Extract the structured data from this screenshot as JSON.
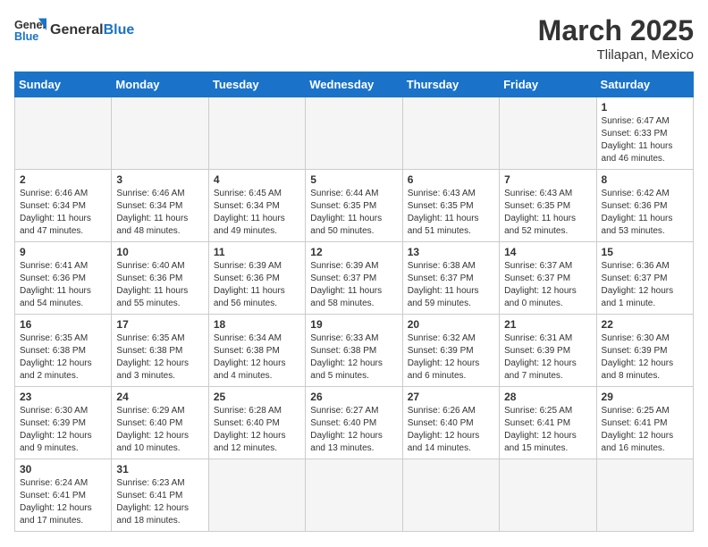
{
  "header": {
    "logo_general": "General",
    "logo_blue": "Blue",
    "month": "March 2025",
    "location": "Tlilapan, Mexico"
  },
  "weekdays": [
    "Sunday",
    "Monday",
    "Tuesday",
    "Wednesday",
    "Thursday",
    "Friday",
    "Saturday"
  ],
  "weeks": [
    [
      {
        "day": "",
        "info": ""
      },
      {
        "day": "",
        "info": ""
      },
      {
        "day": "",
        "info": ""
      },
      {
        "day": "",
        "info": ""
      },
      {
        "day": "",
        "info": ""
      },
      {
        "day": "",
        "info": ""
      },
      {
        "day": "1",
        "info": "Sunrise: 6:47 AM\nSunset: 6:33 PM\nDaylight: 11 hours\nand 46 minutes."
      }
    ],
    [
      {
        "day": "2",
        "info": "Sunrise: 6:46 AM\nSunset: 6:34 PM\nDaylight: 11 hours\nand 47 minutes."
      },
      {
        "day": "3",
        "info": "Sunrise: 6:46 AM\nSunset: 6:34 PM\nDaylight: 11 hours\nand 48 minutes."
      },
      {
        "day": "4",
        "info": "Sunrise: 6:45 AM\nSunset: 6:34 PM\nDaylight: 11 hours\nand 49 minutes."
      },
      {
        "day": "5",
        "info": "Sunrise: 6:44 AM\nSunset: 6:35 PM\nDaylight: 11 hours\nand 50 minutes."
      },
      {
        "day": "6",
        "info": "Sunrise: 6:43 AM\nSunset: 6:35 PM\nDaylight: 11 hours\nand 51 minutes."
      },
      {
        "day": "7",
        "info": "Sunrise: 6:43 AM\nSunset: 6:35 PM\nDaylight: 11 hours\nand 52 minutes."
      },
      {
        "day": "8",
        "info": "Sunrise: 6:42 AM\nSunset: 6:36 PM\nDaylight: 11 hours\nand 53 minutes."
      }
    ],
    [
      {
        "day": "9",
        "info": "Sunrise: 6:41 AM\nSunset: 6:36 PM\nDaylight: 11 hours\nand 54 minutes."
      },
      {
        "day": "10",
        "info": "Sunrise: 6:40 AM\nSunset: 6:36 PM\nDaylight: 11 hours\nand 55 minutes."
      },
      {
        "day": "11",
        "info": "Sunrise: 6:39 AM\nSunset: 6:36 PM\nDaylight: 11 hours\nand 56 minutes."
      },
      {
        "day": "12",
        "info": "Sunrise: 6:39 AM\nSunset: 6:37 PM\nDaylight: 11 hours\nand 58 minutes."
      },
      {
        "day": "13",
        "info": "Sunrise: 6:38 AM\nSunset: 6:37 PM\nDaylight: 11 hours\nand 59 minutes."
      },
      {
        "day": "14",
        "info": "Sunrise: 6:37 AM\nSunset: 6:37 PM\nDaylight: 12 hours\nand 0 minutes."
      },
      {
        "day": "15",
        "info": "Sunrise: 6:36 AM\nSunset: 6:37 PM\nDaylight: 12 hours\nand 1 minute."
      }
    ],
    [
      {
        "day": "16",
        "info": "Sunrise: 6:35 AM\nSunset: 6:38 PM\nDaylight: 12 hours\nand 2 minutes."
      },
      {
        "day": "17",
        "info": "Sunrise: 6:35 AM\nSunset: 6:38 PM\nDaylight: 12 hours\nand 3 minutes."
      },
      {
        "day": "18",
        "info": "Sunrise: 6:34 AM\nSunset: 6:38 PM\nDaylight: 12 hours\nand 4 minutes."
      },
      {
        "day": "19",
        "info": "Sunrise: 6:33 AM\nSunset: 6:38 PM\nDaylight: 12 hours\nand 5 minutes."
      },
      {
        "day": "20",
        "info": "Sunrise: 6:32 AM\nSunset: 6:39 PM\nDaylight: 12 hours\nand 6 minutes."
      },
      {
        "day": "21",
        "info": "Sunrise: 6:31 AM\nSunset: 6:39 PM\nDaylight: 12 hours\nand 7 minutes."
      },
      {
        "day": "22",
        "info": "Sunrise: 6:30 AM\nSunset: 6:39 PM\nDaylight: 12 hours\nand 8 minutes."
      }
    ],
    [
      {
        "day": "23",
        "info": "Sunrise: 6:30 AM\nSunset: 6:39 PM\nDaylight: 12 hours\nand 9 minutes."
      },
      {
        "day": "24",
        "info": "Sunrise: 6:29 AM\nSunset: 6:40 PM\nDaylight: 12 hours\nand 10 minutes."
      },
      {
        "day": "25",
        "info": "Sunrise: 6:28 AM\nSunset: 6:40 PM\nDaylight: 12 hours\nand 12 minutes."
      },
      {
        "day": "26",
        "info": "Sunrise: 6:27 AM\nSunset: 6:40 PM\nDaylight: 12 hours\nand 13 minutes."
      },
      {
        "day": "27",
        "info": "Sunrise: 6:26 AM\nSunset: 6:40 PM\nDaylight: 12 hours\nand 14 minutes."
      },
      {
        "day": "28",
        "info": "Sunrise: 6:25 AM\nSunset: 6:41 PM\nDaylight: 12 hours\nand 15 minutes."
      },
      {
        "day": "29",
        "info": "Sunrise: 6:25 AM\nSunset: 6:41 PM\nDaylight: 12 hours\nand 16 minutes."
      }
    ],
    [
      {
        "day": "30",
        "info": "Sunrise: 6:24 AM\nSunset: 6:41 PM\nDaylight: 12 hours\nand 17 minutes."
      },
      {
        "day": "31",
        "info": "Sunrise: 6:23 AM\nSunset: 6:41 PM\nDaylight: 12 hours\nand 18 minutes."
      },
      {
        "day": "",
        "info": ""
      },
      {
        "day": "",
        "info": ""
      },
      {
        "day": "",
        "info": ""
      },
      {
        "day": "",
        "info": ""
      },
      {
        "day": "",
        "info": ""
      }
    ]
  ]
}
